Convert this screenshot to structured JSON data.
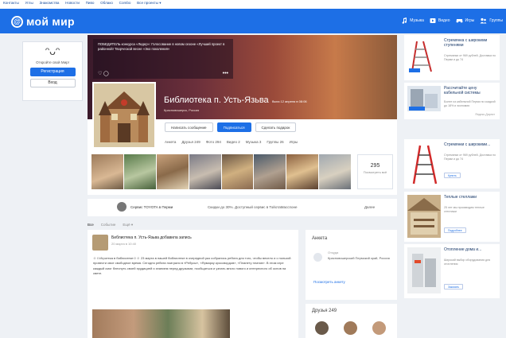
{
  "toplinks": [
    "Контакты",
    "Углы",
    "Знакомства",
    "Новости",
    "Пиво",
    "Облако",
    "Combo",
    "Все проекты ▾"
  ],
  "header": {
    "logo_glyph": "@",
    "logo_text": "мой мир",
    "nav": [
      {
        "icon": "music-icon",
        "label": "Музыка"
      },
      {
        "icon": "video-icon",
        "label": "Видео"
      },
      {
        "icon": "games-icon",
        "label": "Игры"
      },
      {
        "icon": "groups-icon",
        "label": "Группы"
      }
    ],
    "brand_color": "#1d6fe6"
  },
  "leftbox": {
    "smiley": "ᵔᴗᵔ",
    "text": "Откройте свой Мир!",
    "register_label": "Регистрация",
    "login_label": "Вход"
  },
  "profile": {
    "news_text": "ПОБЕДИТЕЛЬ конкурса «Лидер»: Голосование в новом сезоне «Лучший проект в районной! Творческой весне «Эко поколения»",
    "news_icons": "♡  ◯",
    "news_more": "•••",
    "name": "Библиотека п. Усть-Язьва",
    "status": "была 12 апреля в 08:06",
    "city": "Красновишерск, Россия",
    "buttons": [
      "Написать сообщение",
      "Подписаться",
      "Сделать подарок"
    ],
    "tabs": [
      "Анкета",
      "Друзья 249",
      "Фото 294",
      "Видео 2",
      "Музыка 3",
      "Группы 26",
      "Игры"
    ],
    "photo_count": "295",
    "photo_count_label": "Посмотреть всё"
  },
  "adbar": {
    "title": "Сервис TOYOTA в Перми",
    "text": "Скидки до 30%. Доступный сервис в ТойотаМасспоне",
    "link": "Далее"
  },
  "feed": {
    "tabs": [
      "Все",
      "Событие",
      "Ещё ▾"
    ]
  },
  "post": {
    "author": "Библиотека п. Усть-Язьва добавила запись",
    "date": "20 марта в 10:40",
    "text": "☺☺Игротека в библиотеке☺☺ 23 марта в нашей библиотеке в очередной раз собрались ребята для того, чтобы весело и с пользой провести свое свободное время. Сегодня ребята поиграли в «Ребусы», «Ярмарку кроссвордов», «Планету платов». В этом игре каждый смог блеснуть своей эрудицией и знанием перед друзьями, пообщаться и узнать много нового и интересного об основ на свете."
  },
  "about": {
    "title": "Анкета",
    "label": "Откуда",
    "value": "Красновишерский Пермский край, Россия",
    "link": "Посмотреть анкету"
  },
  "friends": {
    "title": "Друзья 249"
  },
  "right_ads": [
    {
      "title": "Стремянка с широкими ступенями",
      "desc": "Стремянки от 969 рублей. Доставка по Перми и до 74",
      "button": "Подробнее"
    },
    {
      "title": "Рассчитайте цену кабельной системы",
      "desc": "Более из кабельной Перми по скидкой до 18% и экономия",
      "button": "Подробнее",
      "source": "Яндекс.Директ"
    },
    {
      "title": "Стремянки с широкими...",
      "desc": "Стремянки от 969 рублей. Доставка по Перми и до 74",
      "button": "Купить"
    },
    {
      "title": "Теплые стеллажи",
      "desc": "25 лет мы производим теплые стеллажи",
      "button": "Подробнее"
    },
    {
      "title": "Отопление дома и...",
      "desc": "Широкий выбор оборудования для отопления",
      "button": "Заказать"
    }
  ]
}
